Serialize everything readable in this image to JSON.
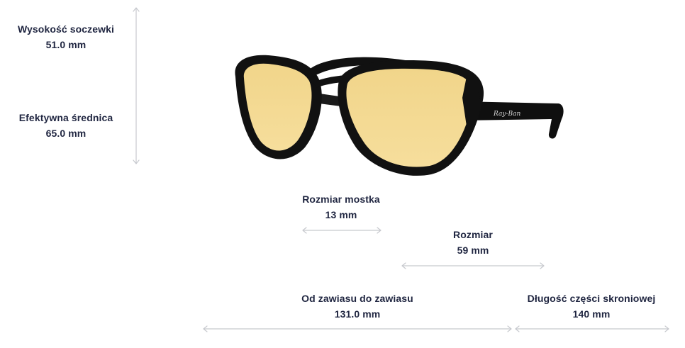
{
  "measurements": {
    "lens_height": {
      "label": "Wysokość soczewki",
      "value": "51.0 mm"
    },
    "effective_diameter": {
      "label": "Efektywna średnica",
      "value": "65.0 mm"
    },
    "bridge_size": {
      "label": "Rozmiar mostka",
      "value": "13 mm"
    },
    "size": {
      "label": "Rozmiar",
      "value": "59 mm"
    },
    "hinge_to_hinge": {
      "label": "Od zawiasu do zawiasu",
      "value": "131.0 mm"
    },
    "temple_length": {
      "label": "Długość części skroniowej",
      "value": "140 mm"
    }
  },
  "product": {
    "logo_text": "Ray-Ban",
    "lens_color": "#f4d98e",
    "frame_color": "#111111"
  },
  "colors": {
    "text": "#1f2540",
    "arrow": "#c7c9ce"
  }
}
